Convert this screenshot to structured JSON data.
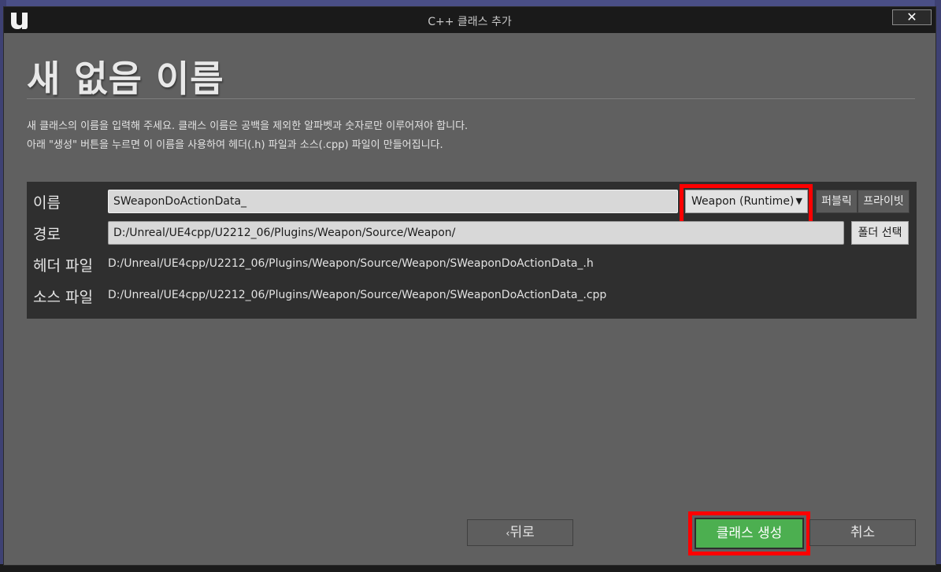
{
  "window": {
    "title": "C++ 클래스 추가",
    "close_label": "✕"
  },
  "page": {
    "heading": "새 없음 이름",
    "description_line1": "새 클래스의 이름을 입력해 주세요. 클래스 이름은 공백을 제외한 알파벳과 숫자로만 이루어져야 합니다.",
    "description_line2": "아래 \"생성\" 버튼을 누르면 이 이름을 사용하여 헤더(.h) 파일과 소스(.cpp) 파일이 만들어집니다."
  },
  "form": {
    "name_label": "이름",
    "name_value": "SWeaponDoActionData_",
    "module_value": "Weapon (Runtime)",
    "public_label": "퍼블릭",
    "private_label": "프라이빗",
    "path_label": "경로",
    "path_value": "D:/Unreal/UE4cpp/U2212_06/Plugins/Weapon/Source/Weapon/",
    "folder_button_label": "폴더 선택",
    "header_label": "헤더 파일",
    "header_value": "D:/Unreal/UE4cpp/U2212_06/Plugins/Weapon/Source/Weapon/SWeaponDoActionData_.h",
    "source_label": "소스 파일",
    "source_value": "D:/Unreal/UE4cpp/U2212_06/Plugins/Weapon/Source/Weapon/SWeaponDoActionData_.cpp"
  },
  "footer": {
    "back_label": "뒤로",
    "back_icon": "chevron-left-icon",
    "create_label": "클래스 생성",
    "cancel_label": "취소"
  },
  "colors": {
    "highlight": "#ff0000",
    "create_button": "#4caf50"
  }
}
